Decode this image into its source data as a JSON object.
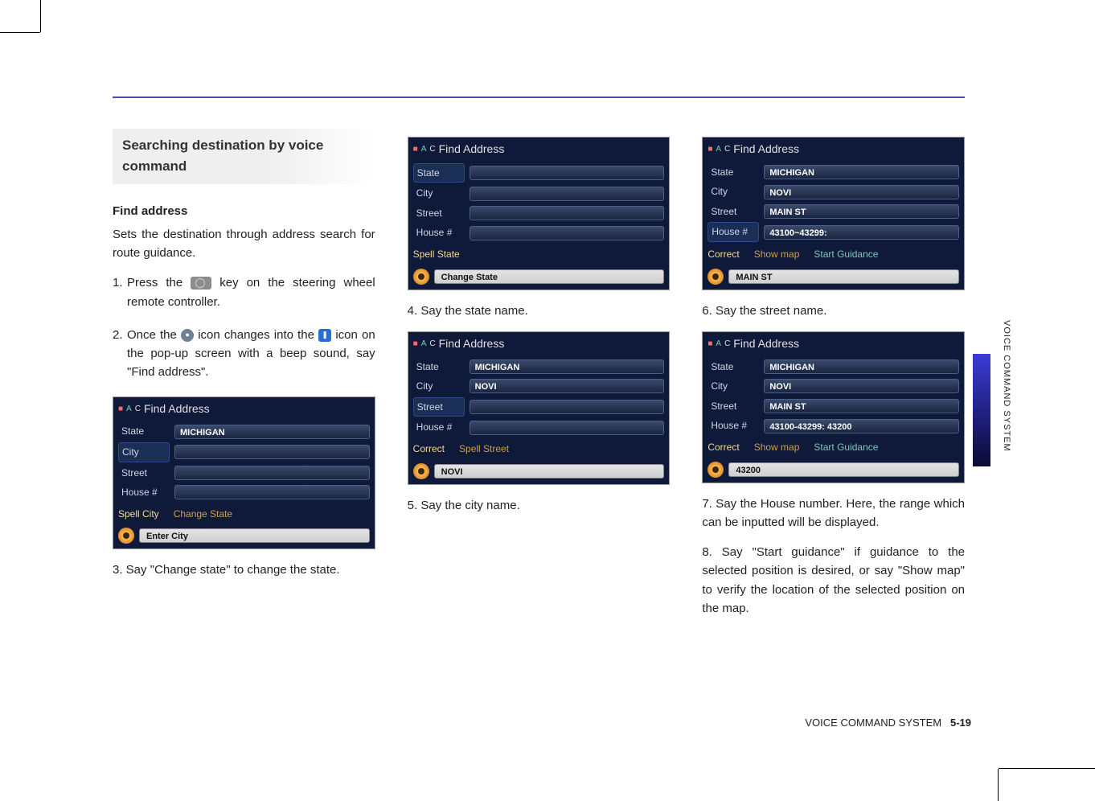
{
  "section_heading": "Searching destination by voice command",
  "subhead": "Find address",
  "intro": "Sets the destination through address search for route guidance.",
  "steps": {
    "s1a": "1.",
    "s1b_pre": "Press the ",
    "s1b_post": " key on the steering wheel remote controller.",
    "s2a": "2.",
    "s2b_pre": "Once the ",
    "s2b_mid": " icon changes into the ",
    "s2b_post": " icon on the pop-up screen with a beep sound, say \"Find address\".",
    "s3": "3. Say \"Change state\" to change the state.",
    "s4": "4. Say the state name.",
    "s5": "5. Say the city name.",
    "s6": "6. Say the street name.",
    "s7": "7. Say the House number. Here, the range which can be inputted will be displayed.",
    "s8": "8. Say \"Start guidance\" if guidance to the selected position is desired, or say \"Show map\" to verify the location of the selected position on the map."
  },
  "shot_title": "Find Address",
  "labels": {
    "state": "State",
    "city": "City",
    "street": "Street",
    "house": "House #",
    "correct": "Correct"
  },
  "cmds": {
    "spell_city": "Spell City",
    "change_state": "Change State",
    "spell_state": "Spell State",
    "spell_street": "Spell Street",
    "show_map": "Show map",
    "start_guidance": "Start Guidance"
  },
  "mic": {
    "enter_city": "Enter City",
    "change_state": "Change State",
    "novi": "NOVI",
    "main_st": "MAIN ST",
    "num": "43200"
  },
  "vals": {
    "michigan": "MICHIGAN",
    "novi": "NOVI",
    "main_st": "MAIN ST",
    "range1": "43100~43299:",
    "range2": "43100-43299: 43200"
  },
  "side_text": "VOICE COMMAND SYSTEM",
  "footer_label": "VOICE COMMAND SYSTEM",
  "footer_page": "5-19"
}
